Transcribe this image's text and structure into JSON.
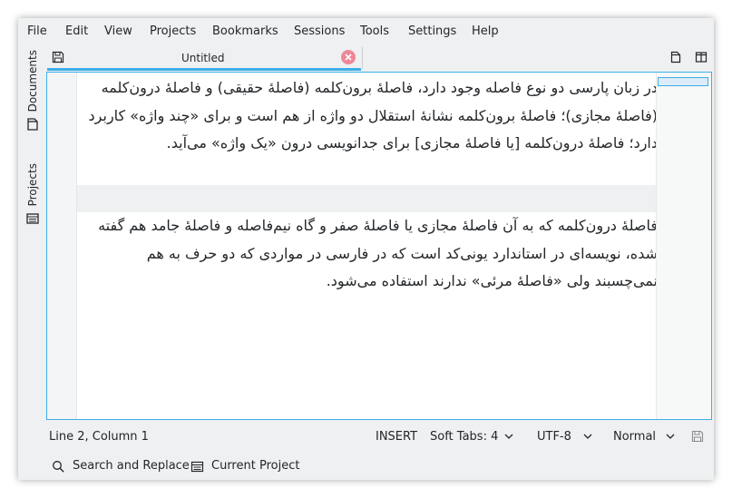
{
  "menubar": {
    "items": [
      "File",
      "Edit",
      "View",
      "Projects",
      "Bookmarks",
      "Sessions",
      "Tools",
      "Settings",
      "Help"
    ]
  },
  "sidebar": {
    "documents_label": "Documents",
    "projects_label": "Projects"
  },
  "tabbar": {
    "document_title": "Untitled"
  },
  "editor": {
    "paragraph_1": "در زبان پارسی دو نوع فاصله وجود دارد، فاصلهٔ برون‌کلمه (فاصلهٔ حقیقی) و فاصلهٔ درون‌کلمه (فاصلهٔ مجازی)؛ فاصلهٔ برون‌کلمه نشانهٔ استقلال دو واژه از هم است و برای «چند واژه» کاربرد دارد؛ فاصلهٔ درون‌کلمه [یا فاصلهٔ مجازی] برای جدانویسی درون «یک واژه» می‌آید.",
    "paragraph_2": "فاصلهٔ درون‌کلمه که به آن فاصلهٔ مجازی یا فاصلهٔ صفر و گاه نیم‌فاصله و فاصلهٔ جامد هم گفته شده، نویسه‌ای در استاندارد یونی‌کد است که در فارسی در مواردی که دو حرف به هم نمی‌چسبند ولی «فاصلهٔ مرئی» ندارند استفاده می‌شود."
  },
  "statusbar": {
    "cursor_position": "Line 2, Column 1",
    "input_mode": "INSERT",
    "indentation": "Soft Tabs: 4",
    "encoding": "UTF-8",
    "highlighting_mode": "Normal"
  },
  "bottombar": {
    "search_label": "Search and Replace",
    "project_label": "Current Project"
  },
  "colors": {
    "accent": "#3daee9",
    "close_button": "#ed8796",
    "background": "#eff0f1"
  }
}
